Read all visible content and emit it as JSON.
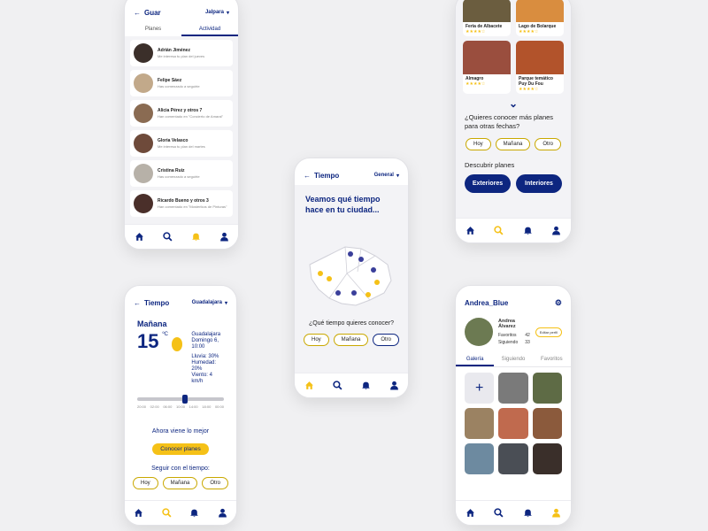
{
  "notifications_screen": {
    "title": "Guar",
    "city": "Jalpara",
    "tabs": [
      "Planes",
      "Actividad"
    ],
    "items": [
      {
        "name": "Adrián Jiménez",
        "msg": "Me interesa tu plan del jueves"
      },
      {
        "name": "Felipe Sáez",
        "msg": "Has comenzado a seguirte"
      },
      {
        "name": "Alicia Pérez y otros 7",
        "msg": "Han comentado en \"Concierto de Amaral\""
      },
      {
        "name": "Gloria Velasco",
        "msg": "Me interesa tu plan del martes"
      },
      {
        "name": "Cristina Ruiz",
        "msg": "Has comenzado a seguirte"
      },
      {
        "name": "Ricardo Bueno y otros 3",
        "msg": "Han comentado en \"Mosterikos de Pinturas\""
      }
    ]
  },
  "plans_screen": {
    "cards": [
      {
        "title": "Feria de Albacete",
        "color": "#6b5d3f"
      },
      {
        "title": "Lago de Bolarque",
        "color": "#d98d3f"
      },
      {
        "title": "Almagro",
        "color": "#9a4e3e"
      },
      {
        "title": "Parque temático Puy Du Fou",
        "color": "#b2532b"
      }
    ],
    "question": "¿Quieres conocer más planes para otras fechas?",
    "date_options": [
      "Hoy",
      "Mañana",
      "Otro"
    ],
    "discover_label": "Descubrir planes",
    "btn_exteriores": "Exteriores",
    "btn_interiores": "Interiores"
  },
  "weather_map_screen": {
    "title": "Tiempo",
    "selector": "General",
    "heading": "Veamos qué tiempo hace en tu ciudad...",
    "question": "¿Qué tiempo quieres conocer?",
    "date_options": [
      "Hoy",
      "Mañana",
      "Otro"
    ]
  },
  "weather_detail_screen": {
    "title": "Tiempo",
    "city_selector": "Guadalajara",
    "day": "Mañana",
    "temperature": "15",
    "unit": "ºC",
    "city": "Guadalajara",
    "datetime": "Domingo 6, 10:00",
    "rain": "Lluvia: 30%",
    "humidity": "Humedad: 20%",
    "wind": "Viento: 4 km/h",
    "slider_times": [
      "20:00",
      "02:00",
      "06:00",
      "10:00",
      "14:00",
      "18:00",
      "00:00"
    ],
    "next_best": "Ahora viene lo mejor",
    "btn_planes": "Conocer planes",
    "continue_label": "Seguir con el tiempo:",
    "date_options": [
      "Hoy",
      "Mañana",
      "Otro"
    ]
  },
  "profile_screen": {
    "username": "Andrea_Blue",
    "full_name": "Andrea Álvarez",
    "favorites_label": "Favoritos",
    "favorites_count": "42",
    "following_label": "Siguiendo",
    "following_count": "33",
    "edit_button": "Editar perfil",
    "tabs": [
      "Galería",
      "Siguiendo",
      "Favoritos"
    ],
    "add_symbol": "+"
  },
  "colors": {
    "navy": "#0d2680",
    "gold": "#f5c117"
  }
}
